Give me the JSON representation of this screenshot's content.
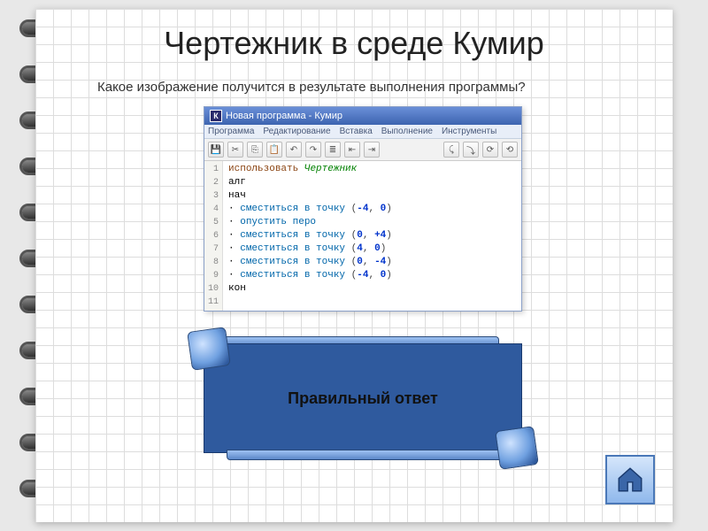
{
  "title": "Чертежник в среде Кумир",
  "question": "Какое изображение получится в результате выполнения программы?",
  "editor": {
    "window_title": "Новая программа - Кумир",
    "logo_letter": "К",
    "menu": [
      "Программа",
      "Редактирование",
      "Вставка",
      "Выполнение",
      "Инструменты"
    ],
    "toolbar_icons": [
      "save-icon",
      "cut-icon",
      "copy-icon",
      "paste-icon",
      "undo-icon",
      "redo-icon",
      "list-icon",
      "outdent-icon",
      "indent-icon",
      "run-icon",
      "step-icon",
      "stop-icon",
      "debug-icon"
    ],
    "toolbar_glyphs": [
      "💾",
      "✂",
      "⎘",
      "📋",
      "↶",
      "↷",
      "≣",
      "⇤",
      "⇥",
      "⤹",
      "⤵",
      "⟳",
      "⟲"
    ],
    "line_numbers": [
      "1",
      "2",
      "3",
      "4",
      "5",
      "6",
      "7",
      "8",
      "9",
      "10",
      "11"
    ],
    "code": {
      "l1": {
        "use": "использовать",
        "ident": "Чертежник"
      },
      "l2": {
        "kw": "алг"
      },
      "l3": {
        "kw": "нач"
      },
      "l4": {
        "cmd": "сместиться в точку",
        "a": "-4",
        "b": "0"
      },
      "l5": {
        "cmd": "опустить перо"
      },
      "l6": {
        "cmd": "сместиться в точку",
        "a": "0",
        "b": "+4"
      },
      "l7": {
        "cmd": "сместиться в точку",
        "a": "4",
        "b": "0"
      },
      "l8": {
        "cmd": "сместиться в точку",
        "a": "0",
        "b": "-4"
      },
      "l9": {
        "cmd": "сместиться в точку",
        "a": "-4",
        "b": "0"
      },
      "l10": {
        "kw": "кон"
      }
    }
  },
  "answer": {
    "label": "Правильный ответ"
  },
  "home_button": {
    "name": "home-icon"
  }
}
